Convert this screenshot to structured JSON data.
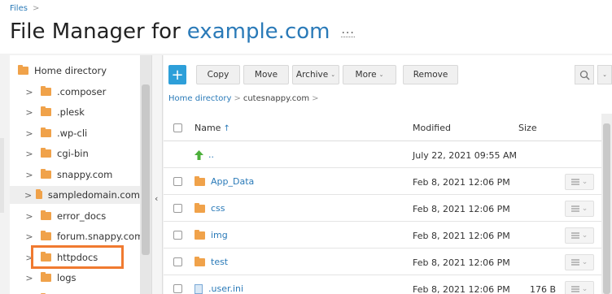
{
  "breadcrumb_top": {
    "label": "Files",
    "sep": ">"
  },
  "header": {
    "title_prefix": "File Manager for",
    "domain": "example.com",
    "more": "..."
  },
  "tree": {
    "root": "Home directory",
    "items": [
      {
        "label": ".composer"
      },
      {
        "label": ".plesk"
      },
      {
        "label": ".wp-cli"
      },
      {
        "label": "cgi-bin"
      },
      {
        "label": "snappy.com"
      },
      {
        "label": "sampledomain.com"
      },
      {
        "label": "error_docs"
      },
      {
        "label": "forum.snappy.com"
      },
      {
        "label": "httpdocs"
      },
      {
        "label": "logs"
      }
    ],
    "chevron": ">",
    "collapse_arrow": "‹"
  },
  "toolbar": {
    "add": "+",
    "copy": "Copy",
    "move": "Move",
    "archive": "Archive",
    "more": "More",
    "remove": "Remove",
    "dropdown_glyph": "⌄"
  },
  "breadcrumb": {
    "home": "Home directory",
    "current": "cutesnappy.com",
    "sep": ">"
  },
  "table": {
    "headers": {
      "name": "Name",
      "sort_glyph": "↑",
      "modified": "Modified",
      "size": "Size"
    },
    "rows": [
      {
        "name": "..",
        "modified": "July 22, 2021 09:55 AM",
        "size": ""
      },
      {
        "name": "App_Data",
        "modified": "Feb 8, 2021 12:06 PM",
        "size": ""
      },
      {
        "name": "css",
        "modified": "Feb 8, 2021 12:06 PM",
        "size": ""
      },
      {
        "name": "img",
        "modified": "Feb 8, 2021 12:06 PM",
        "size": ""
      },
      {
        "name": "test",
        "modified": "Feb 8, 2021 12:06 PM",
        "size": ""
      },
      {
        "name": ".user.ini",
        "modified": "Feb 8, 2021 12:06 PM",
        "size": "176 B"
      }
    ]
  },
  "colors": {
    "accent": "#2a7ab8",
    "folder": "#f0a24a",
    "highlight": "#f07a30",
    "add_button": "#2d9fd9"
  }
}
